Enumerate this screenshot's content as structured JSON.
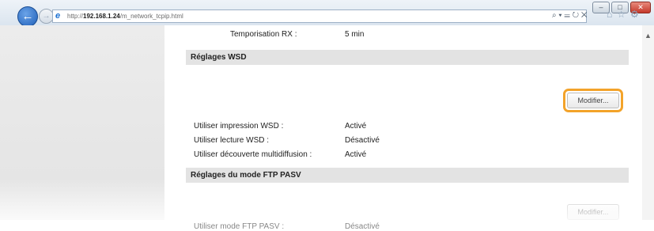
{
  "browser": {
    "url_prefix": "http://",
    "url_host": "192.168.1.24",
    "url_path": "/m_network_tcpip.html",
    "search_icon": "search-icon",
    "address_tools": "⌕ ▾ ☰ ↻ ✕"
  },
  "content": {
    "rx_timeout": {
      "label": "Temporisation RX :",
      "value": "5 min"
    },
    "wsd": {
      "title": "Réglages WSD",
      "edit_label": "Modifier...",
      "rows": [
        {
          "label": "Utiliser impression WSD :",
          "value": "Activé"
        },
        {
          "label": "Utiliser lecture WSD :",
          "value": "Désactivé"
        },
        {
          "label": "Utiliser découverte multidiffusion :",
          "value": "Activé"
        }
      ]
    },
    "ftp": {
      "title": "Réglages du mode FTP PASV",
      "edit_label": "Modifier...",
      "rows": [
        {
          "label": "Utiliser mode FTP PASV :",
          "value": "Désactivé"
        }
      ]
    }
  },
  "colors": {
    "highlight": "#f3a32a",
    "section_bg": "#e3e3e3",
    "sidebar_bg": "#e8e8e8"
  }
}
